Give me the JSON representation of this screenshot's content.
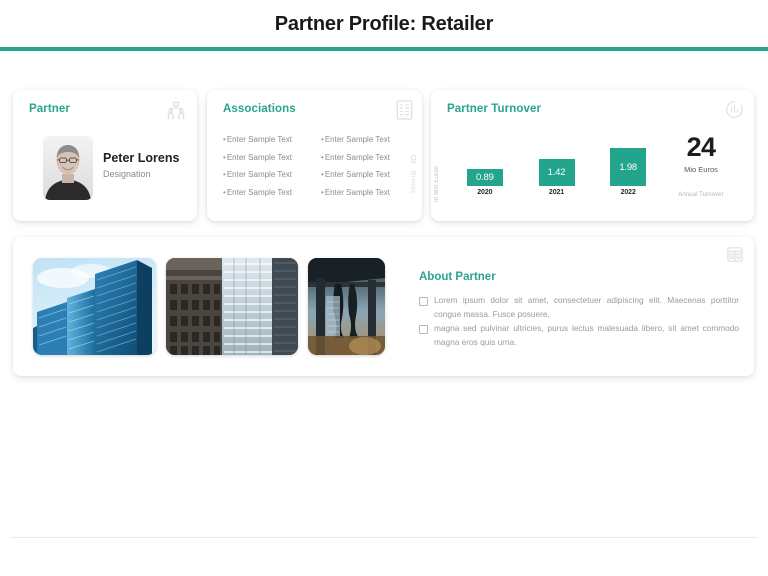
{
  "header": {
    "title": "Partner Profile: Retailer",
    "accent_color": "#2aa58c"
  },
  "partner_card": {
    "title": "Partner",
    "icon": "org-chart-people-icon",
    "avatar": "partner-photo",
    "name": "Peter Lorens",
    "designation": "Designation"
  },
  "associations_card": {
    "title": "Associations",
    "icon": "list-document-icon",
    "side_tab_label": "Brands",
    "side_tab_icon": "brand-tag-icon",
    "column_left": [
      "Enter Sample Text",
      "Enter Sample Text",
      "Enter Sample Text",
      "Enter Sample Text"
    ],
    "column_right": [
      "Enter Sample Text",
      "Enter Sample Text",
      "Enter Sample Text",
      "Enter Sample Text"
    ]
  },
  "turnover_card": {
    "title": "Partner Turnover",
    "icon": "bar-chart-circle-icon",
    "kpi_value": "24",
    "kpi_unit": "Mio Euros",
    "kpi_caption": "Annual Turnover"
  },
  "chart_data": {
    "type": "bar",
    "title": "Partner Turnover",
    "categories": [
      "2020",
      "2021",
      "2022"
    ],
    "values": [
      0.89,
      1.42,
      1.98
    ],
    "value_labels": [
      "0.89",
      "1.42",
      "1.98"
    ],
    "xlabel": "",
    "ylabel": "In Mio Euros",
    "ylim": [
      0,
      2.4
    ],
    "grid": false,
    "legend": false,
    "series_color": "#22a58c"
  },
  "about_card": {
    "icon": "window-layout-icon",
    "title": "About Partner",
    "bullets": [
      "Lorem ipsum dolor sit amet, consectetuer adipiscing elit. Maecenas porttitor congue massa. Fusce posuere,",
      "magna sed pulvinar ultricies, purus lectus malesuada libero, sit amet commodo magna eros quis urna."
    ],
    "images": [
      "glass-skyscrapers-blue-sky-photo",
      "office-building-facade-photo",
      "industrial-structure-photo"
    ]
  }
}
